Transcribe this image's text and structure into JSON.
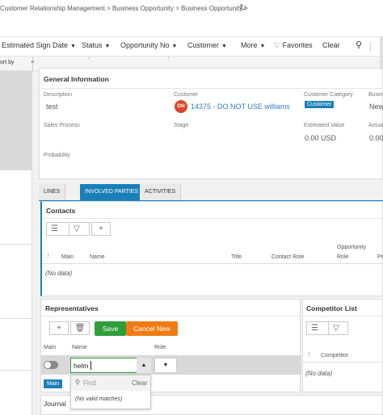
{
  "breadcrumb": "Customer Relationship Management > Business Opportunity > Business Opportunity >",
  "filters": [
    {
      "label": "Estimated Sign Date"
    },
    {
      "label": "Status"
    },
    {
      "label": "Opportunity No"
    },
    {
      "label": "Customer"
    },
    {
      "label": "More"
    }
  ],
  "toolbar": {
    "favorites": "Favorites",
    "clear": "Clear"
  },
  "sort": {
    "label": "ort by"
  },
  "general": {
    "title": "General Information",
    "description_label": "Description",
    "description_value": "test",
    "customer_label": "Customer",
    "customer_initials": "DN",
    "customer_value": "14375 - DO NOT USE williams",
    "customer_category_label": "Customer Category",
    "customer_category_value": "Customer",
    "business_label": "Busin",
    "business_value": "New",
    "sales_process_label": "Sales Process",
    "stage_label": "Stage",
    "estimated_value_label": "Estimated Value",
    "estimated_value": "0.00 USD",
    "actual_label": "Actua",
    "actual_value": "0.00",
    "probability_label": "Probability"
  },
  "tabs": [
    {
      "label": "LINES",
      "active": false
    },
    {
      "label": "INVOLVED PARTIES",
      "active": true
    },
    {
      "label": "ACTIVITIES",
      "active": false
    }
  ],
  "contacts": {
    "title": "Contacts",
    "columns": [
      "Main",
      "Name",
      "Title",
      "Contact Role",
      "Opportunity",
      "Role",
      "Pr"
    ],
    "empty": "(No data)"
  },
  "representatives": {
    "title": "Representatives",
    "save": "Save",
    "cancel": "Cancel New",
    "columns": [
      "Main",
      "Name",
      "Role"
    ],
    "name_value": "helm",
    "main_badge": "Main",
    "dropdown_placeholder": "Find",
    "dropdown_clear": "Clear",
    "dropdown_empty": "(No valid matches)"
  },
  "competitors": {
    "title": "Competitor List",
    "column": "Competitor",
    "empty": "(No data)"
  },
  "journal": {
    "title": "Journal"
  },
  "colors": {
    "accent": "#1a7fb8",
    "save": "#2e9e3b",
    "cancel": "#f07b14",
    "avatar": "#d9452a",
    "link": "#2a7fc1"
  }
}
